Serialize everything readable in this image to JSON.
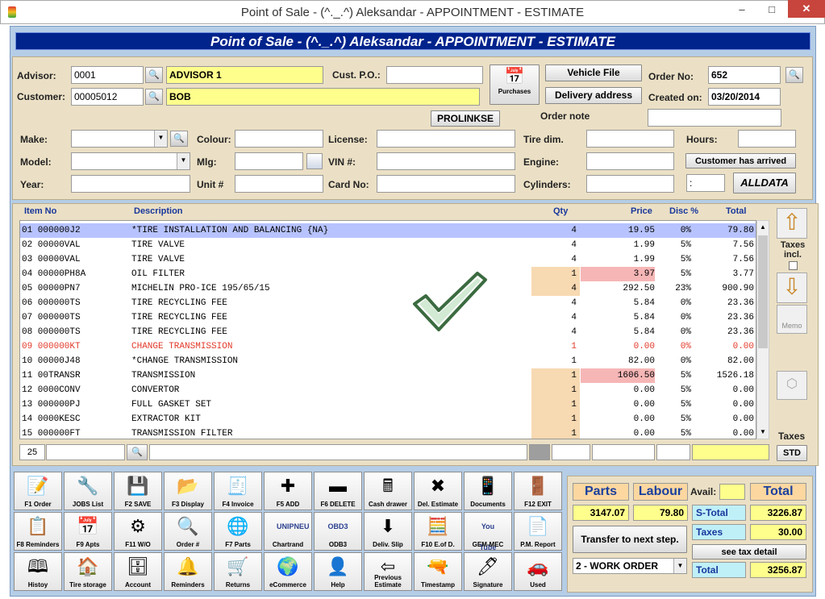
{
  "window": {
    "title": "Point of Sale - (^._.^) Aleksandar - APPOINTMENT - ESTIMATE",
    "minimize": "–",
    "maximize": "□",
    "close": "✕"
  },
  "banner": "Point of Sale - (^._.^) Aleksandar - APPOINTMENT - ESTIMATE",
  "header": {
    "advisor_label": "Advisor:",
    "advisor_code": "0001",
    "advisor_name": "ADVISOR 1",
    "customer_label": "Customer:",
    "customer_code": "00005012",
    "customer_name": "BOB",
    "cust_po_label": "Cust. P.O.:",
    "cust_po": "",
    "purchases_label": "Purchases",
    "vehicle_file_label": "Vehicle File",
    "delivery_address_label": "Delivery address",
    "order_no_label": "Order No:",
    "order_no": "652",
    "created_on_label": "Created on:",
    "created_on": "03/20/2014",
    "order_note_label": "Order note",
    "prolinkse_label": "PROLINKSE",
    "make_label": "Make:",
    "colour_label": "Colour:",
    "license_label": "License:",
    "tire_dim_label": "Tire dim.",
    "hours_label": "Hours:",
    "model_label": "Model:",
    "mlg_label": "Mlg:",
    "vin_label": "VIN #:",
    "engine_label": "Engine:",
    "customer_arrived_label": "Customer has arrived",
    "year_label": "Year:",
    "unit_label": "Unit #",
    "card_no_label": "Card No:",
    "cylinders_label": "Cylinders:",
    "colon_field": ":",
    "alldata_label": "ALLDATA"
  },
  "grid": {
    "columns": {
      "item_no": "Item No",
      "description": "Description",
      "qty": "Qty",
      "price": "Price",
      "disc": "Disc %",
      "total": "Total"
    },
    "rows": [
      {
        "n": "01",
        "item": "000000J2",
        "desc": "*TIRE INSTALLATION AND BALANCING {NA}",
        "qty": "4",
        "price": "19.95",
        "disc": "0%",
        "total": "79.80",
        "sel": true
      },
      {
        "n": "02",
        "item": "00000VAL",
        "desc": "TIRE VALVE",
        "qty": "4",
        "price": "1.99",
        "disc": "5%",
        "total": "7.56"
      },
      {
        "n": "03",
        "item": "00000VAL",
        "desc": "TIRE VALVE",
        "qty": "4",
        "price": "1.99",
        "disc": "5%",
        "total": "7.56"
      },
      {
        "n": "04",
        "item": "00000PH8A",
        "desc": "OIL FILTER",
        "qty": "1",
        "price": "3.97",
        "disc": "5%",
        "total": "3.77",
        "qhl": true,
        "phl": true
      },
      {
        "n": "05",
        "item": "00000PN7",
        "desc": "MICHELIN PRO-ICE 195/65/15",
        "qty": "4",
        "price": "292.50",
        "disc": "23%",
        "total": "900.90",
        "qhl": true
      },
      {
        "n": "06",
        "item": "000000TS",
        "desc": "TIRE RECYCLING FEE",
        "qty": "4",
        "price": "5.84",
        "disc": "0%",
        "total": "23.36"
      },
      {
        "n": "07",
        "item": "000000TS",
        "desc": "TIRE RECYCLING FEE",
        "qty": "4",
        "price": "5.84",
        "disc": "0%",
        "total": "23.36"
      },
      {
        "n": "08",
        "item": "000000TS",
        "desc": "TIRE RECYCLING FEE",
        "qty": "4",
        "price": "5.84",
        "disc": "0%",
        "total": "23.36"
      },
      {
        "n": "09",
        "item": "000000KT",
        "desc": "CHANGE TRANSMISSION",
        "qty": "1",
        "price": "0.00",
        "disc": "0%",
        "total": "0.00",
        "red": true
      },
      {
        "n": "10",
        "item": "00000J48",
        "desc": "*CHANGE TRANSMISSION",
        "qty": "1",
        "price": "82.00",
        "disc": "0%",
        "total": "82.00"
      },
      {
        "n": "11",
        "item": "00TRANSR",
        "desc": "TRANSMISSION",
        "qty": "1",
        "price": "1606.50",
        "disc": "5%",
        "total": "1526.18",
        "qhl": true,
        "phl": true
      },
      {
        "n": "12",
        "item": "0000CONV",
        "desc": "CONVERTOR",
        "qty": "1",
        "price": "0.00",
        "disc": "5%",
        "total": "0.00",
        "qhl": true
      },
      {
        "n": "13",
        "item": "000000PJ",
        "desc": "FULL GASKET SET",
        "qty": "1",
        "price": "0.00",
        "disc": "5%",
        "total": "0.00",
        "qhl": true
      },
      {
        "n": "14",
        "item": "0000KESC",
        "desc": "EXTRACTOR KIT",
        "qty": "1",
        "price": "0.00",
        "disc": "5%",
        "total": "0.00",
        "qhl": true
      },
      {
        "n": "15",
        "item": "000000FT",
        "desc": "TRANSMISSION FILTER",
        "qty": "1",
        "price": "0.00",
        "disc": "5%",
        "total": "0.00",
        "qhl": true
      }
    ],
    "footer_line": "25"
  },
  "side": {
    "taxes_incl": "Taxes incl.",
    "memo": "Memo",
    "taxes": "Taxes",
    "std": "STD"
  },
  "toolbar": [
    {
      "label": "F1 Order",
      "icon": "📝",
      "name": "f1-order"
    },
    {
      "label": "JOBS List",
      "icon": "🔧",
      "name": "jobs-list"
    },
    {
      "label": "F2 SAVE",
      "icon": "💾",
      "name": "f2-save"
    },
    {
      "label": "F3 Display",
      "icon": "📂",
      "name": "f3-display"
    },
    {
      "label": "F4 Invoice",
      "icon": "🧾",
      "name": "f4-invoice"
    },
    {
      "label": "F5 ADD",
      "icon": "✚",
      "name": "f5-add"
    },
    {
      "label": "F6 DELETE",
      "icon": "▬",
      "name": "f6-delete"
    },
    {
      "label": "Cash drawer",
      "icon": "🖩",
      "name": "cash-drawer"
    },
    {
      "label": "Del. Estimate",
      "icon": "✖",
      "name": "del-estimate"
    },
    {
      "label": "Documents",
      "icon": "📱",
      "name": "documents"
    },
    {
      "label": "F12 EXIT",
      "icon": "🚪",
      "name": "f12-exit"
    },
    {
      "label": "F8 Reminders",
      "icon": "📋",
      "name": "f8-reminders"
    },
    {
      "label": "F9 Apts",
      "icon": "📅",
      "name": "f9-apts"
    },
    {
      "label": "F11 W/O",
      "icon": "⚙",
      "name": "f11-wo"
    },
    {
      "label": "Order #",
      "icon": "🔍",
      "name": "order-number"
    },
    {
      "label": "F7 Parts",
      "icon": "🌐",
      "name": "f7-parts"
    },
    {
      "label": "Chartrand",
      "icon": "UNIPNEU",
      "name": "chartrand"
    },
    {
      "label": "ODB3",
      "icon": "OBD3",
      "name": "odb3"
    },
    {
      "label": "Deliv. Slip",
      "icon": "⬇",
      "name": "deliv-slip"
    },
    {
      "label": "F10 E.of D.",
      "icon": "🧮",
      "name": "f10-eod"
    },
    {
      "label": "GEM-MEC",
      "icon": "You Tube",
      "name": "gem-mec"
    },
    {
      "label": "P.M. Report",
      "icon": "📄",
      "name": "pm-report"
    },
    {
      "label": "Histoy",
      "icon": "🕮",
      "name": "history"
    },
    {
      "label": "Tire storage",
      "icon": "🏠",
      "name": "tire-storage"
    },
    {
      "label": "Account",
      "icon": "🗄",
      "name": "account"
    },
    {
      "label": "Reminders",
      "icon": "🔔",
      "name": "reminders"
    },
    {
      "label": "Returns",
      "icon": "🛒",
      "name": "returns"
    },
    {
      "label": "eCommerce",
      "icon": "🌍",
      "name": "ecommerce"
    },
    {
      "label": "Help",
      "icon": "👤",
      "name": "help"
    },
    {
      "label": "Previous Estimate",
      "icon": "⇦",
      "name": "previous-estimate"
    },
    {
      "label": "Timestamp",
      "icon": "🔫",
      "name": "timestamp"
    },
    {
      "label": "Signature",
      "icon": "🖊",
      "name": "signature"
    },
    {
      "label": "Used",
      "icon": "🚗",
      "name": "used"
    }
  ],
  "totals": {
    "parts_label": "Parts",
    "parts": "3147.07",
    "labour_label": "Labour",
    "labour": "79.80",
    "avail_label": "Avail:",
    "total_label": "Total",
    "s_total_label": "S-Total",
    "s_total": "3226.87",
    "taxes_label": "Taxes",
    "taxes": "30.00",
    "see_tax_detail": "see tax detail",
    "transfer_label": "Transfer to next step.",
    "order_type": "2 - WORK ORDER",
    "total_final_label": "Total",
    "total_final": "3256.87"
  }
}
